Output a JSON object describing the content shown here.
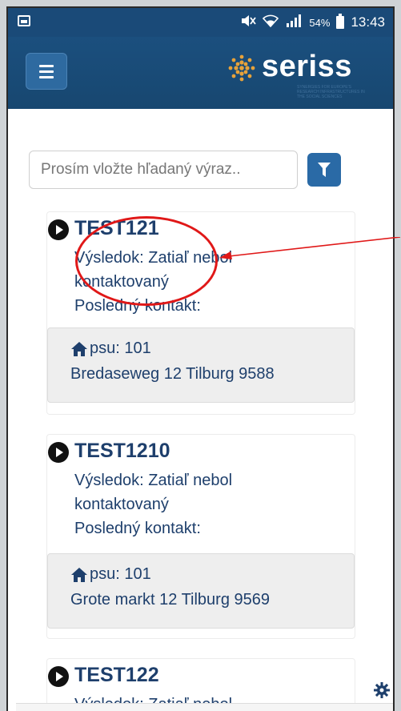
{
  "status_bar": {
    "battery_percent": "54%",
    "time": "13:43",
    "icons": [
      "gallery-icon",
      "mute-icon",
      "wifi-icon",
      "signal-icon",
      "battery-icon"
    ]
  },
  "header": {
    "logo_text": "seriss",
    "logo_subtitle": "synergies for europe's research infrastructures in the social sciences",
    "menu_icon": "hamburger-icon"
  },
  "search": {
    "placeholder": "Prosím vložte hľadaný výraz..",
    "filter_icon": "filter-icon"
  },
  "cases": [
    {
      "title": "TEST121",
      "result": "Výsledok: Zatiaľ nebol",
      "result_cont": "kontaktovaný",
      "last_contact": "Posledný kontakt:",
      "psu": "psu: 101",
      "address": "Bredaseweg 12 Tilburg 9588"
    },
    {
      "title": "TEST1210",
      "result": "Výsledok: Zatiaľ nebol",
      "result_cont": "kontaktovaný",
      "last_contact": "Posledný kontakt:",
      "psu": "psu: 101",
      "address": "Grote markt 12 Tilburg 9569"
    },
    {
      "title": "TEST122",
      "result": "Výsledok: Zatiaľ nebol"
    }
  ],
  "colors": {
    "primary": "#1b4f7e",
    "text": "#1e3f6c",
    "accent_button": "#2a6aa6",
    "annotation": "#e01818"
  }
}
